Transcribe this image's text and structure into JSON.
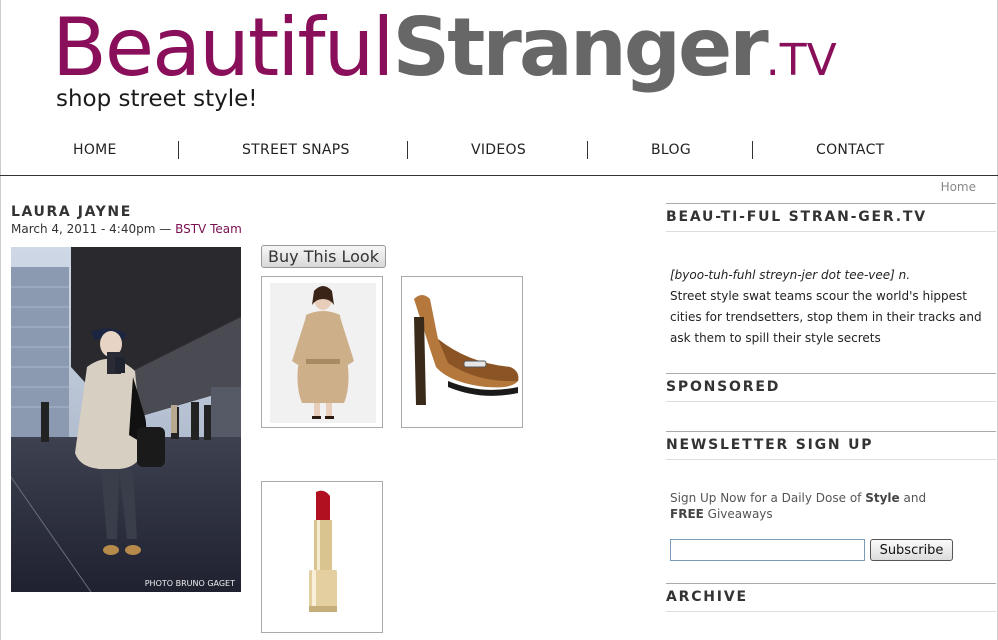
{
  "logo": {
    "part1": "Beautiful",
    "part2": "Stranger",
    "part3": ".TV",
    "tagline": "shop street style!"
  },
  "nav": {
    "items": [
      {
        "label": "HOME"
      },
      {
        "label": "STREET SNAPS"
      },
      {
        "label": "VIDEOS"
      },
      {
        "label": "BLOG"
      },
      {
        "label": "CONTACT"
      }
    ]
  },
  "breadcrumb": "Home",
  "post": {
    "title": "LAURA JAYNE",
    "date": "March 4, 2011 - 4:40pm",
    "separator": "—",
    "author": "BSTV Team",
    "photo_credit": "PHOTO BRUNO GAGET",
    "buy_label": "Buy This Look"
  },
  "sidebar": {
    "about_title": "BEAU-TI-FUL STRAN-GER.TV",
    "pronunciation": "[byoo-tuh-fuhl streyn-jer dot tee-vee] n.",
    "description": "Street style swat teams scour the world's hippest cities for trendsetters, stop them in their tracks and ask them to spill their style secrets",
    "sponsored_title": "SPONSORED",
    "newsletter_title": "NEWSLETTER SIGN UP",
    "newsletter_text_a": "Sign Up Now for a Daily Dose of ",
    "newsletter_text_b": "Style",
    "newsletter_text_c": " and ",
    "newsletter_text_d": "FREE",
    "newsletter_text_e": " Giveaways",
    "email_value": "",
    "subscribe_label": "Subscribe",
    "archive_title": "ARCHIVE"
  },
  "colors": {
    "brand_purple": "#8a0f5a",
    "brand_gray": "#676767"
  }
}
